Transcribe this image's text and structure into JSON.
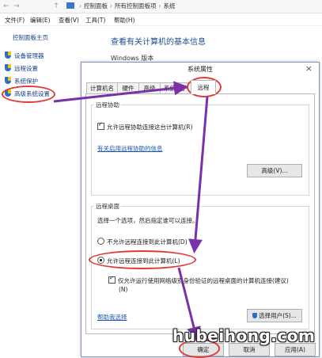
{
  "addressbar": {
    "back": "←",
    "forward": "→",
    "up": "↑",
    "crumbs": [
      "控制面板",
      "所有控制面板项",
      "系统"
    ]
  },
  "menubar": {
    "items": [
      "文件(F)",
      "编辑(E)",
      "查看(V)",
      "工具(T)",
      "帮助(H)"
    ]
  },
  "sidebar": {
    "home": "控制面板主页",
    "items": [
      "设备管理器",
      "远程设置",
      "系统保护",
      "高级系统设置"
    ]
  },
  "main": {
    "heading": "查看有关计算机的基本信息",
    "edition_label": "Windows 版本"
  },
  "dialog": {
    "title": "系统属性",
    "close": "×",
    "tabs": [
      "计算机名",
      "硬件",
      "高级",
      "系统保护",
      "远程"
    ],
    "active_tab": "远程",
    "remote_assist": {
      "group_title": "远程协助",
      "checkbox_label": "允许远程协助连接这台计算机(R)",
      "checked": true,
      "link": "有关启用远程协助的信息",
      "advanced_button": "高级(V)..."
    },
    "remote_desktop": {
      "group_title": "远程桌面",
      "instruction": "选择一个选项，然后指定谁可以连接。",
      "option_deny": "不允许远程连接到此计算机(D)",
      "option_allow": "允许远程连接到此计算机(L)",
      "selected": "allow",
      "nla_label": "仅允许运行使用网络级别身份验证的远程桌面的计算机连接(建议)",
      "nla_shortcut": "(N)",
      "nla_checked": true,
      "help_link": "帮助我选择",
      "select_users_button": "选择用户(S)..."
    },
    "buttons": {
      "ok": "确定",
      "cancel": "取消",
      "apply": "应用(A)"
    }
  },
  "watermark": "hubeihong.com",
  "colors": {
    "annotation_ring": "#e03a3a",
    "annotation_arrow": "#7b2fa8",
    "link": "#1a55b0"
  }
}
